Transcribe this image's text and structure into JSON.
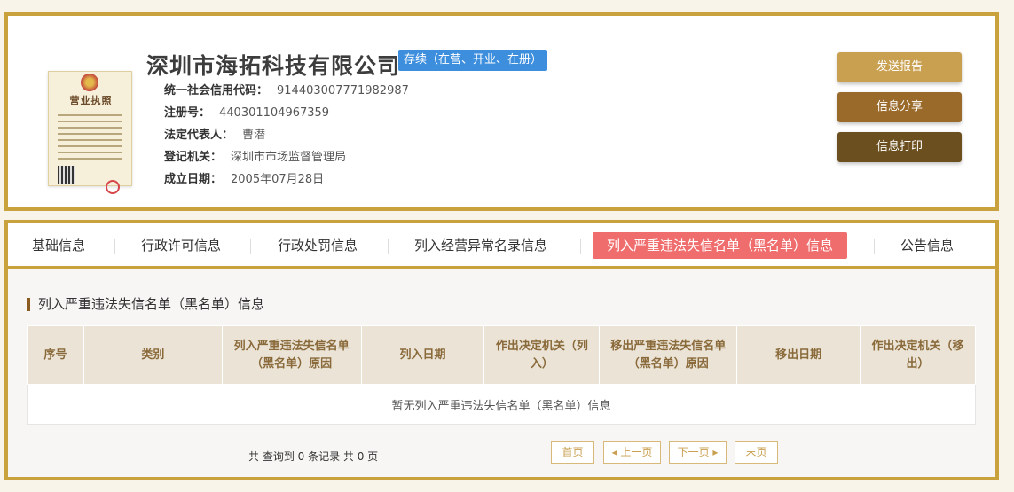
{
  "company": {
    "name": "深圳市海拓科技有限公司",
    "status": "存续（在营、开业、在册）",
    "info": [
      {
        "label": "统一社会信用代码：",
        "value": "914403007771982987"
      },
      {
        "label": "注册号：",
        "value": "440301104967359"
      },
      {
        "label": "法定代表人：",
        "value": "曹潜"
      },
      {
        "label": "登记机关：",
        "value": "深圳市市场监督管理局"
      },
      {
        "label": "成立日期：",
        "value": "2005年07月28日"
      }
    ],
    "license_title": "营业执照"
  },
  "actions": {
    "report": "发送报告",
    "share": "信息分享",
    "print": "信息打印"
  },
  "tabs": [
    "基础信息",
    "行政许可信息",
    "行政处罚信息",
    "列入经营异常名录信息",
    "列入严重违法失信名单（黑名单）信息",
    "公告信息"
  ],
  "section": {
    "title": "列入严重违法失信名单（黑名单）信息",
    "columns": [
      "序号",
      "类别",
      "列入严重违法失信名单（黑名单）原因",
      "列入日期",
      "作出决定机关（列入）",
      "移出严重违法失信名单（黑名单）原因",
      "移出日期",
      "作出决定机关（移出）"
    ],
    "empty_text": "暂无列入严重违法失信名单（黑名单）信息"
  },
  "pagination": {
    "summary": "共 查询到 0 条记录 共 0 页",
    "first": "首页",
    "prev": "上一页",
    "next": "下一页",
    "last": "末页"
  },
  "colors": {
    "frame": "#c9a23e",
    "badge": "#3d8fde",
    "active_tab": "#f06d6d"
  }
}
